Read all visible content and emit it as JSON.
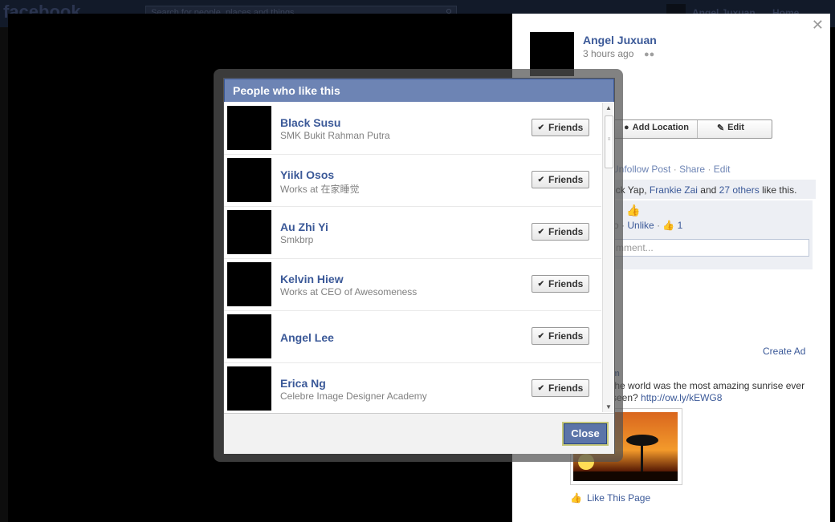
{
  "background": {
    "logo": "facebook",
    "search_placeholder": "Search for people, places and things",
    "user_name": "Angel Juxuan",
    "home_link": "Home"
  },
  "photo_panel": {
    "owner_name": "Angel Juxuan",
    "timestamp": "3 hours ago",
    "audience_icon": "friends-audience-icon",
    "add_location_label": "Add Location",
    "edit_label": "Edit",
    "actions": [
      "Unfollow Post",
      "Share",
      "Edit"
    ],
    "likes_prefix": "ick Yap,",
    "likes_link1": "Frankie Zai",
    "likes_and": "and",
    "likes_link2": "27 others",
    "likes_suffix": "like this.",
    "comment_meta_prefix": "o ·",
    "unlike_label": "Unlike",
    "like_count": "1",
    "comment_placeholder": "mment...",
    "create_ad": "Create Ad",
    "ad_head": "m",
    "ad_text": "the world was the most amazing sunrise ever seen?",
    "ad_url": "http://ow.ly/kEWG8",
    "like_this_page": "Like This Page"
  },
  "dialog": {
    "title": "People who like this",
    "close_label": "Close",
    "people": [
      {
        "name": "Black Susu",
        "sub": "SMK Bukit Rahman Putra",
        "button": "Friends"
      },
      {
        "name": "Yiikl Osos",
        "sub": "Works at 在家睡觉",
        "button": "Friends"
      },
      {
        "name": "Au Zhi Yi",
        "sub": "Smkbrp",
        "button": "Friends"
      },
      {
        "name": "Kelvin Hiew",
        "sub": "Works at CEO of Awesomeness",
        "button": "Friends"
      },
      {
        "name": "Angel Lee",
        "sub": "",
        "button": "Friends"
      },
      {
        "name": "Erica Ng",
        "sub": "Celebre Image Designer Academy",
        "button": "Friends"
      }
    ]
  }
}
